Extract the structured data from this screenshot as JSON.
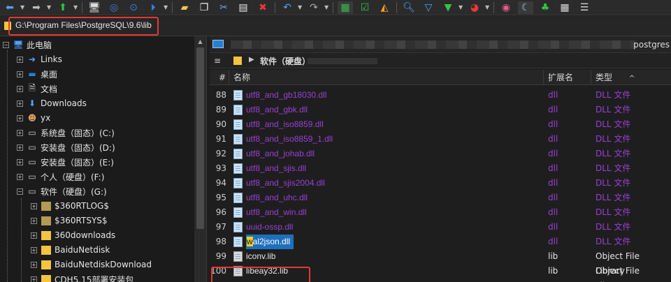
{
  "toolbar": {
    "icons": [
      "back-arrow-icon",
      "forward-arrow-icon",
      "up-arrow-icon",
      "computer-icon",
      "target-icon",
      "search-icon",
      "media-play-icon",
      "new-folder-icon",
      "copy-icon",
      "cut-icon",
      "paste-icon",
      "delete-icon",
      "undo-icon",
      "redo-icon",
      "tree-view-icon",
      "checkbox-icon",
      "pizza-icon",
      "find-icon",
      "filter-icon",
      "filter-add-icon",
      "pie-chart-icon",
      "spiral-icon",
      "moon-icon",
      "tree-icon",
      "calendar-icon",
      "list-icon"
    ]
  },
  "address": {
    "path": "G:\\Program Files\\PostgreSQL\\9.6\\lib"
  },
  "tree": {
    "items": [
      {
        "label": "此电脑",
        "icon": "computer-icon",
        "expander": "−"
      },
      {
        "label": "Links",
        "icon": "arrow-right-icon",
        "expander": "+"
      },
      {
        "label": "桌面",
        "icon": "desktop-icon",
        "expander": "+"
      },
      {
        "label": "文档",
        "icon": "document-icon",
        "expander": "+"
      },
      {
        "label": "Downloads",
        "icon": "download-icon",
        "expander": "+"
      },
      {
        "label": "yx",
        "icon": "user-icon",
        "expander": "+"
      },
      {
        "label": "系统盘（固态）(C:)",
        "icon": "drive-icon",
        "expander": "+"
      },
      {
        "label": "安装盘（固态）(D:)",
        "icon": "drive-icon",
        "expander": "+"
      },
      {
        "label": "安装盘（固态）(E:)",
        "icon": "drive-icon",
        "expander": "+"
      },
      {
        "label": "个人（硬盘）(F:)",
        "icon": "drive-icon",
        "expander": "+"
      },
      {
        "label": "软件（硬盘）(G:)",
        "icon": "drive-icon",
        "expander": "−"
      },
      {
        "label": "$360RTLOG$",
        "icon": "folder-icon",
        "expander": "+"
      },
      {
        "label": "$360RTSYS$",
        "icon": "folder-icon",
        "expander": "+"
      },
      {
        "label": "360downloads",
        "icon": "folder-icon",
        "expander": "+"
      },
      {
        "label": "BaiduNetdisk",
        "icon": "folder-icon",
        "expander": "+"
      },
      {
        "label": "BaiduNetdiskDownload",
        "icon": "folder-icon",
        "expander": "+"
      },
      {
        "label": "CDH5.15部署安装包",
        "icon": "folder-icon",
        "expander": "+"
      }
    ]
  },
  "pane": {
    "tab_right": "postgres",
    "crumb_menu": "≡",
    "crumb_label": "软件（硬盘）",
    "columns": {
      "num": "#",
      "name": "名称",
      "ext": "扩展名",
      "type": "类型",
      "type_sort": "^"
    },
    "files": [
      {
        "num": "88",
        "name": "utf8_and_gb18030.dll",
        "ext": "dll",
        "type": "DLL 文件"
      },
      {
        "num": "89",
        "name": "utf8_and_gbk.dll",
        "ext": "dll",
        "type": "DLL 文件"
      },
      {
        "num": "90",
        "name": "utf8_and_iso8859.dll",
        "ext": "dll",
        "type": "DLL 文件"
      },
      {
        "num": "91",
        "name": "utf8_and_iso8859_1.dll",
        "ext": "dll",
        "type": "DLL 文件"
      },
      {
        "num": "92",
        "name": "utf8_and_johab.dll",
        "ext": "dll",
        "type": "DLL 文件"
      },
      {
        "num": "93",
        "name": "utf8_and_sjis.dll",
        "ext": "dll",
        "type": "DLL 文件"
      },
      {
        "num": "94",
        "name": "utf8_and_sjis2004.dll",
        "ext": "dll",
        "type": "DLL 文件"
      },
      {
        "num": "95",
        "name": "utf8_and_uhc.dll",
        "ext": "dll",
        "type": "DLL 文件"
      },
      {
        "num": "96",
        "name": "utf8_and_win.dll",
        "ext": "dll",
        "type": "DLL 文件"
      },
      {
        "num": "97",
        "name": "uuid-ossp.dll",
        "ext": "dll",
        "type": "DLL 文件"
      }
    ],
    "selected": {
      "num": "98",
      "name_first": "w",
      "name_rest": "al2json.dll",
      "ext": "dll",
      "type": "DLL 文件"
    },
    "more_files": [
      {
        "num": "99",
        "name": "iconv.lib",
        "ext": "lib",
        "type": "Object File Library"
      },
      {
        "num": "100",
        "name": "libeay32.lib",
        "ext": "lib",
        "type": "Object File Library"
      }
    ]
  },
  "colors": {
    "dll_text": "#9b3fd8",
    "selection": "#1f6fbd",
    "highlight_box": "#e53935",
    "folder": "#f5c342"
  }
}
